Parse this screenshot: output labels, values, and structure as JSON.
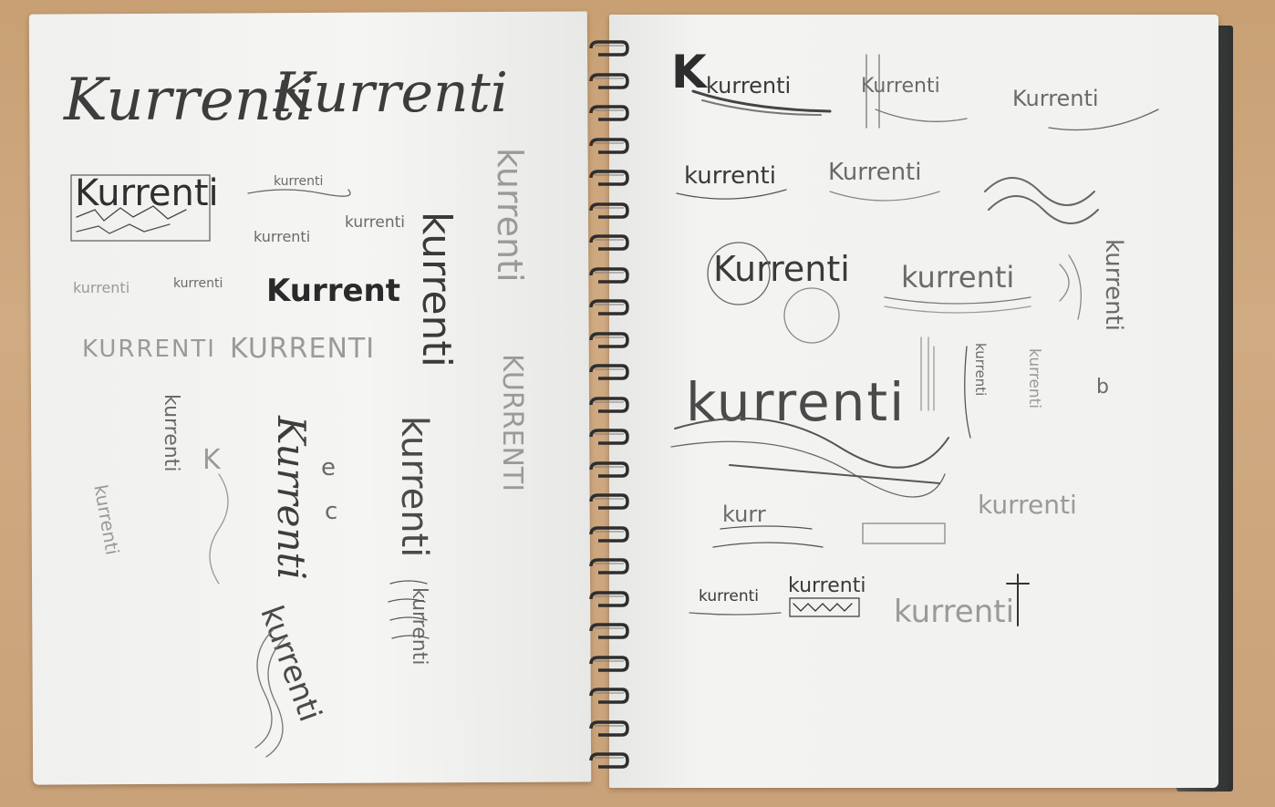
{
  "sketchbook": {
    "word": "kurrenti",
    "word_capital": "Kurrenti",
    "word_short": "Kurrent",
    "word_upper": "KURRENTI",
    "word_upper_partial": "KURRENTI",
    "letter_k": "K",
    "letter_e": "e",
    "letter_c": "c",
    "fragment_kurr": "kurr",
    "fragment_b": "b"
  }
}
